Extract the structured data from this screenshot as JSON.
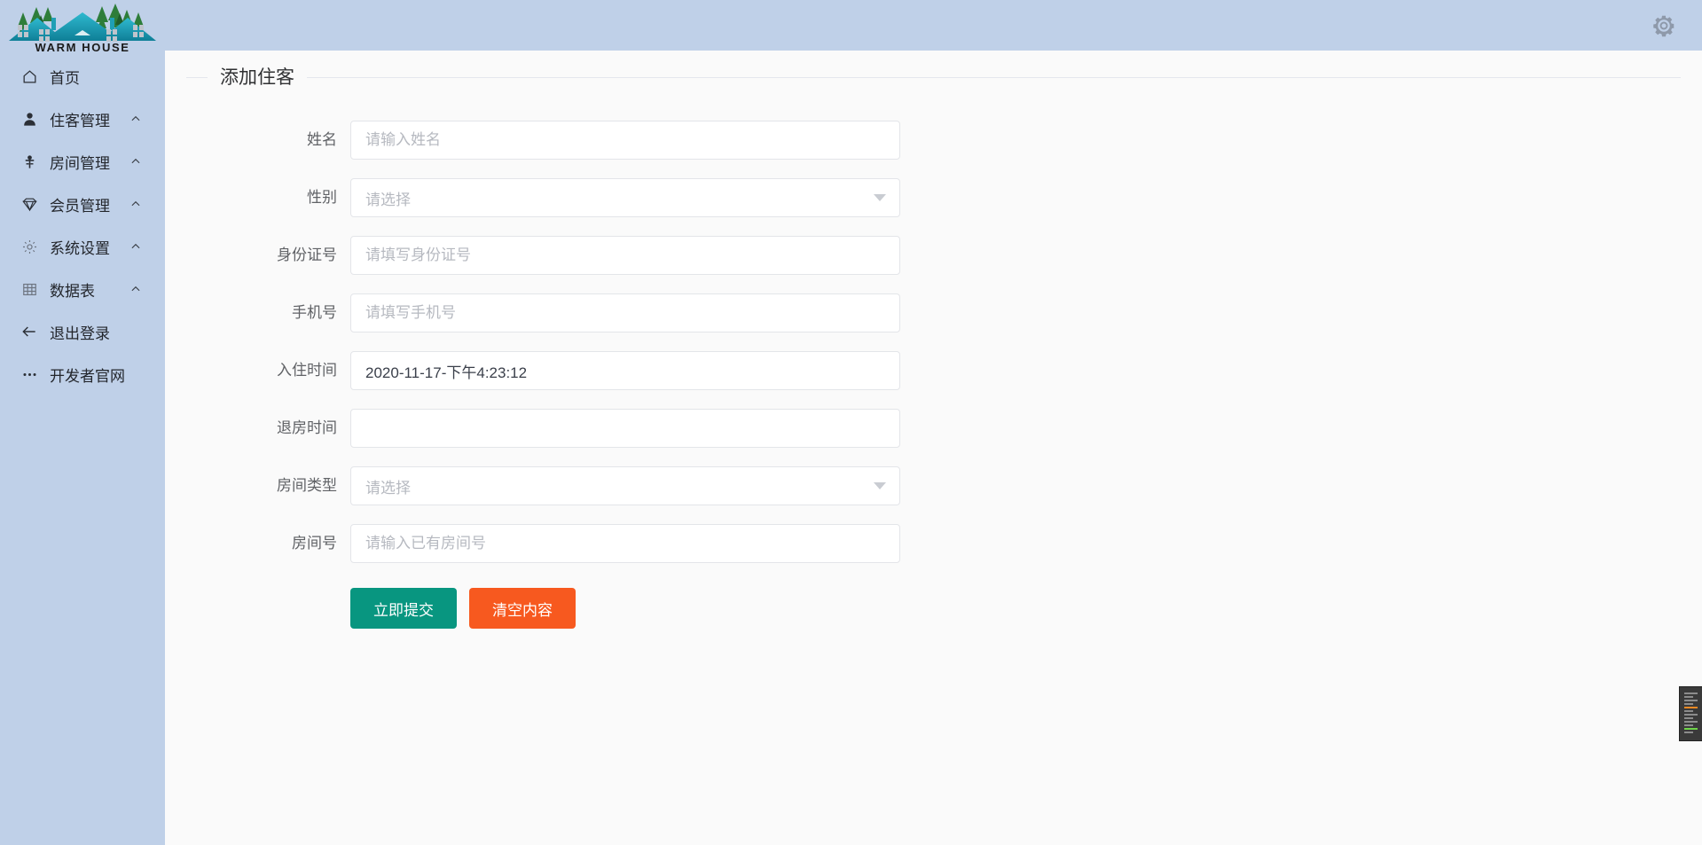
{
  "brand": {
    "name": "WARM HOUSE",
    "logo_icon": "house-trees-logo"
  },
  "header": {
    "settings_icon": "gear-icon"
  },
  "sidebar": {
    "items": [
      {
        "label": "首页",
        "icon": "home-icon",
        "caret": false
      },
      {
        "label": "住客管理",
        "icon": "user-icon",
        "caret": true
      },
      {
        "label": "房间管理",
        "icon": "key-icon",
        "caret": true
      },
      {
        "label": "会员管理",
        "icon": "diamond-icon",
        "caret": true
      },
      {
        "label": "系统设置",
        "icon": "gear-icon",
        "caret": true
      },
      {
        "label": "数据表",
        "icon": "table-icon",
        "caret": true
      },
      {
        "label": "退出登录",
        "icon": "arrow-left-icon",
        "caret": false
      },
      {
        "label": "开发者官网",
        "icon": "ellipsis-icon",
        "caret": false
      }
    ]
  },
  "form": {
    "title": "添加住客",
    "fields": [
      {
        "label": "姓名",
        "type": "input",
        "value": "",
        "placeholder": "请输入姓名"
      },
      {
        "label": "性别",
        "type": "select",
        "value": "",
        "placeholder": "请选择"
      },
      {
        "label": "身份证号",
        "type": "input",
        "value": "",
        "placeholder": "请填写身份证号"
      },
      {
        "label": "手机号",
        "type": "input",
        "value": "",
        "placeholder": "请填写手机号"
      },
      {
        "label": "入住时间",
        "type": "input",
        "value": "2020-11-17-下午4:23:12",
        "placeholder": ""
      },
      {
        "label": "退房时间",
        "type": "input",
        "value": "",
        "placeholder": ""
      },
      {
        "label": "房间类型",
        "type": "select",
        "value": "",
        "placeholder": "请选择"
      },
      {
        "label": "房间号",
        "type": "input",
        "value": "",
        "placeholder": "请输入已有房间号"
      }
    ],
    "submit_label": "立即提交",
    "reset_label": "清空内容"
  },
  "colors": {
    "sidebar_bg": "#bfd0e8",
    "header_bg": "#bfd0e8",
    "content_bg": "#fafafa",
    "submit_btn": "#089680",
    "reset_btn": "#f7591f",
    "logo_roof": "#1f9fb5",
    "logo_tree": "#2e7d3a"
  }
}
